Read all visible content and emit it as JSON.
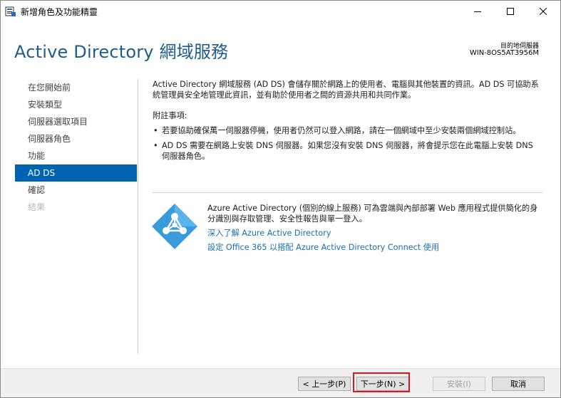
{
  "window": {
    "title": "新增角色及功能精靈"
  },
  "header": {
    "title": "Active Directory 網域服務",
    "destination_label": "目的地伺服器",
    "destination_server": "WIN-8OS5AT3956M"
  },
  "sidebar": {
    "items": [
      {
        "label": "在您開始前",
        "state": "normal"
      },
      {
        "label": "安裝類型",
        "state": "normal"
      },
      {
        "label": "伺服器選取項目",
        "state": "normal"
      },
      {
        "label": "伺服器角色",
        "state": "normal"
      },
      {
        "label": "功能",
        "state": "normal"
      },
      {
        "label": "AD DS",
        "state": "active"
      },
      {
        "label": "確認",
        "state": "normal"
      },
      {
        "label": "結果",
        "state": "disabled"
      }
    ]
  },
  "content": {
    "intro": "Active Directory 網域服務 (AD DS) 會儲存關於網路上的使用者、電腦與其他裝置的資訊。AD DS 可協助系統管理員安全地管理此資訊，並有助於使用者之間的資源共用和共同作業。",
    "notes_heading": "附註事項:",
    "notes": [
      "若要協助確保萬一伺服器停機，使用者仍然可以登入網路，請在一個網域中至少安裝兩個網域控制站。",
      "AD DS 需要在網路上安裝 DNS 伺服器。如果您沒有安裝 DNS 伺服器，將會提示您在此電腦上安裝 DNS 伺服器角色。"
    ],
    "azure_text": "Azure Active Directory (個別的線上服務) 可為雲端與內部部署 Web 應用程式提供簡化的身分識別與存取管理、安全性報告與單一登入。",
    "azure_link1": "深入了解 Azure Active Directory",
    "azure_link2": "設定 Office 365 以搭配 Azure Active Directory Connect 使用"
  },
  "footer": {
    "prev": "< 上一步(P)",
    "next": "下一步(N) >",
    "install": "安裝(I)",
    "cancel": "取消"
  },
  "colors": {
    "accent": "#0063b1",
    "title_blue": "#1f5c8b",
    "link": "#1a6fb3",
    "highlight_red": "#d9191e",
    "azure_icon": "#3a9bdc"
  }
}
